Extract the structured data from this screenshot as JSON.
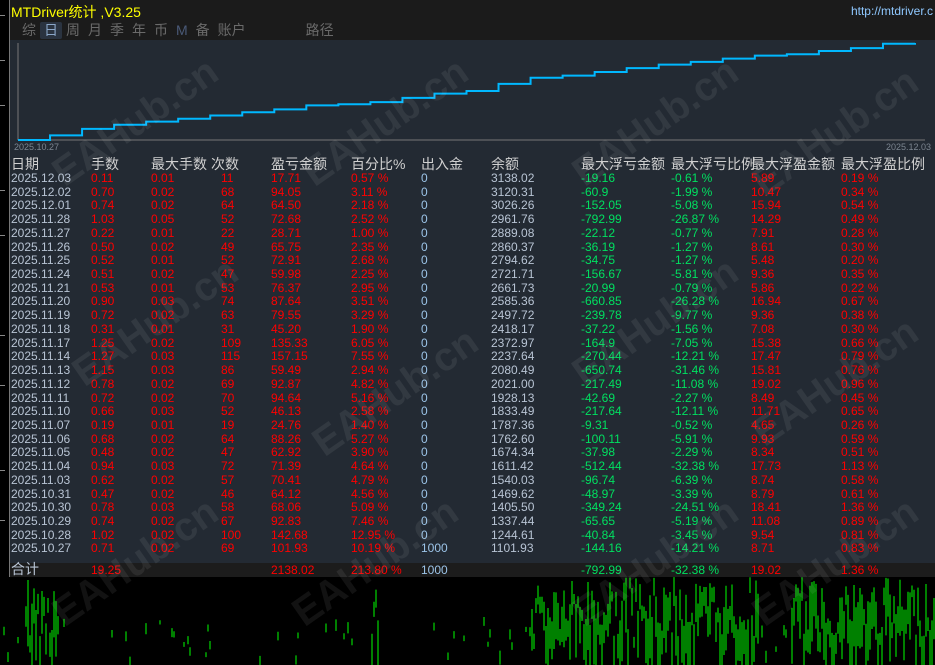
{
  "app": {
    "title": "MTDriver统计 ,V3.25",
    "url": "http://mtdriver.c"
  },
  "tabs": [
    {
      "label": "综"
    },
    {
      "label": "日",
      "active": true
    },
    {
      "label": "周"
    },
    {
      "label": "月"
    },
    {
      "label": "季"
    },
    {
      "label": "年"
    },
    {
      "label": "币"
    },
    {
      "label": "M"
    },
    {
      "label": "备"
    },
    {
      "label": "账户"
    },
    {
      "label": "路径"
    }
  ],
  "chart": {
    "start_label": "2025.10.27",
    "end_label": "2025.12.03",
    "line_color": "#00b8ff",
    "initial_balance": 1000
  },
  "watermark": "EAHub.cn",
  "columns": [
    "日期",
    "手数",
    "最大手数",
    "次数",
    "盈亏金额",
    "百分比%",
    "出入金",
    "余额",
    "最大浮亏金额",
    "最大浮亏比例",
    "最大浮盈金额",
    "最大浮盈比例"
  ],
  "rows": [
    [
      "2025.12.03",
      "0.11",
      "0.01",
      "11",
      "17.71",
      "0.57 %",
      "0",
      "3138.02",
      "-19.16",
      "-0.61 %",
      "5.89",
      "0.19 %"
    ],
    [
      "2025.12.02",
      "0.70",
      "0.02",
      "68",
      "94.05",
      "3.11 %",
      "0",
      "3120.31",
      "-60.9",
      "-1.99 %",
      "10.47",
      "0.34 %"
    ],
    [
      "2025.12.01",
      "0.74",
      "0.02",
      "64",
      "64.50",
      "2.18 %",
      "0",
      "3026.26",
      "-152.05",
      "-5.08 %",
      "15.94",
      "0.54 %"
    ],
    [
      "2025.11.28",
      "1.03",
      "0.05",
      "52",
      "72.68",
      "2.52 %",
      "0",
      "2961.76",
      "-792.99",
      "-26.87 %",
      "14.29",
      "0.49 %"
    ],
    [
      "2025.11.27",
      "0.22",
      "0.01",
      "22",
      "28.71",
      "1.00 %",
      "0",
      "2889.08",
      "-22.12",
      "-0.77 %",
      "7.91",
      "0.28 %"
    ],
    [
      "2025.11.26",
      "0.50",
      "0.02",
      "49",
      "65.75",
      "2.35 %",
      "0",
      "2860.37",
      "-36.19",
      "-1.27 %",
      "8.61",
      "0.30 %"
    ],
    [
      "2025.11.25",
      "0.52",
      "0.01",
      "52",
      "72.91",
      "2.68 %",
      "0",
      "2794.62",
      "-34.75",
      "-1.27 %",
      "5.48",
      "0.20 %"
    ],
    [
      "2025.11.24",
      "0.51",
      "0.02",
      "47",
      "59.98",
      "2.25 %",
      "0",
      "2721.71",
      "-156.67",
      "-5.81 %",
      "9.36",
      "0.35 %"
    ],
    [
      "2025.11.21",
      "0.53",
      "0.01",
      "53",
      "76.37",
      "2.95 %",
      "0",
      "2661.73",
      "-20.99",
      "-0.79 %",
      "5.86",
      "0.22 %"
    ],
    [
      "2025.11.20",
      "0.90",
      "0.03",
      "74",
      "87.64",
      "3.51 %",
      "0",
      "2585.36",
      "-660.85",
      "-26.28 %",
      "16.94",
      "0.67 %"
    ],
    [
      "2025.11.19",
      "0.72",
      "0.02",
      "63",
      "79.55",
      "3.29 %",
      "0",
      "2497.72",
      "-239.78",
      "-9.77 %",
      "9.36",
      "0.38 %"
    ],
    [
      "2025.11.18",
      "0.31",
      "0.01",
      "31",
      "45.20",
      "1.90 %",
      "0",
      "2418.17",
      "-37.22",
      "-1.56 %",
      "7.08",
      "0.30 %"
    ],
    [
      "2025.11.17",
      "1.25",
      "0.02",
      "109",
      "135.33",
      "6.05 %",
      "0",
      "2372.97",
      "-164.9",
      "-7.05 %",
      "15.38",
      "0.66 %"
    ],
    [
      "2025.11.14",
      "1.27",
      "0.03",
      "115",
      "157.15",
      "7.55 %",
      "0",
      "2237.64",
      "-270.44",
      "-12.21 %",
      "17.47",
      "0.79 %"
    ],
    [
      "2025.11.13",
      "1.15",
      "0.03",
      "86",
      "59.49",
      "2.94 %",
      "0",
      "2080.49",
      "-650.74",
      "-31.46 %",
      "15.81",
      "0.76 %"
    ],
    [
      "2025.11.12",
      "0.78",
      "0.02",
      "69",
      "92.87",
      "4.82 %",
      "0",
      "2021.00",
      "-217.49",
      "-11.08 %",
      "19.02",
      "0.96 %"
    ],
    [
      "2025.11.11",
      "0.72",
      "0.02",
      "70",
      "94.64",
      "5.16 %",
      "0",
      "1928.13",
      "-42.69",
      "-2.27 %",
      "8.49",
      "0.45 %"
    ],
    [
      "2025.11.10",
      "0.66",
      "0.03",
      "52",
      "46.13",
      "2.58 %",
      "0",
      "1833.49",
      "-217.64",
      "-12.11 %",
      "11.71",
      "0.65 %"
    ],
    [
      "2025.11.07",
      "0.19",
      "0.01",
      "19",
      "24.76",
      "1.40 %",
      "0",
      "1787.36",
      "-9.31",
      "-0.52 %",
      "4.65",
      "0.26 %"
    ],
    [
      "2025.11.06",
      "0.68",
      "0.02",
      "64",
      "88.26",
      "5.27 %",
      "0",
      "1762.60",
      "-100.11",
      "-5.91 %",
      "9.93",
      "0.59 %"
    ],
    [
      "2025.11.05",
      "0.48",
      "0.02",
      "47",
      "62.92",
      "3.90 %",
      "0",
      "1674.34",
      "-37.98",
      "-2.29 %",
      "8.34",
      "0.51 %"
    ],
    [
      "2025.11.04",
      "0.94",
      "0.03",
      "72",
      "71.39",
      "4.64 %",
      "0",
      "1611.42",
      "-512.44",
      "-32.38 %",
      "17.73",
      "1.13 %"
    ],
    [
      "2025.11.03",
      "0.62",
      "0.02",
      "57",
      "70.41",
      "4.79 %",
      "0",
      "1540.03",
      "-96.74",
      "-6.39 %",
      "8.74",
      "0.58 %"
    ],
    [
      "2025.10.31",
      "0.47",
      "0.02",
      "46",
      "64.12",
      "4.56 %",
      "0",
      "1469.62",
      "-48.97",
      "-3.39 %",
      "8.79",
      "0.61 %"
    ],
    [
      "2025.10.30",
      "0.78",
      "0.03",
      "58",
      "68.06",
      "5.09 %",
      "0",
      "1405.50",
      "-349.24",
      "-24.51 %",
      "18.41",
      "1.36 %"
    ],
    [
      "2025.10.29",
      "0.74",
      "0.02",
      "67",
      "92.83",
      "7.46 %",
      "0",
      "1337.44",
      "-65.65",
      "-5.19 %",
      "11.08",
      "0.89 %"
    ],
    [
      "2025.10.28",
      "1.02",
      "0.02",
      "100",
      "142.68",
      "12.95 %",
      "0",
      "1244.61",
      "-40.84",
      "-3.45 %",
      "9.54",
      "0.81 %"
    ],
    [
      "2025.10.27",
      "0.71",
      "0.02",
      "69",
      "101.93",
      "10.19 %",
      "1000",
      "1101.93",
      "-144.16",
      "-14.21 %",
      "8.71",
      "0.83 %"
    ]
  ],
  "totals": [
    "合计",
    "19.25",
    "",
    "",
    "2138.02",
    "213.80 %",
    "1000",
    "",
    "-792.99",
    "-32.38 %",
    "19.02",
    "1.36 %"
  ]
}
